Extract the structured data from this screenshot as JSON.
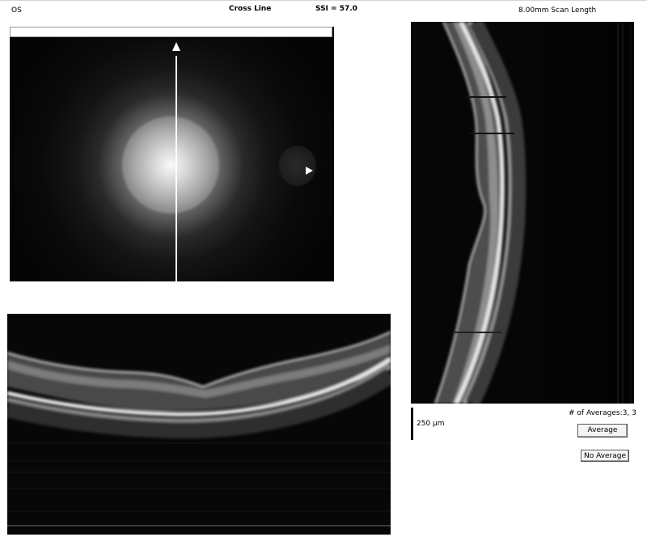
{
  "header": {
    "eye": "OS",
    "scan_pattern": "Cross Line",
    "ssi": "SSI = 57.0",
    "scan_length": "8.00mm Scan Length"
  },
  "averages": {
    "label": "# of Averages:3, 3",
    "scale_label": "250 µm",
    "average_button": "Average",
    "no_average_button": "No Average"
  }
}
